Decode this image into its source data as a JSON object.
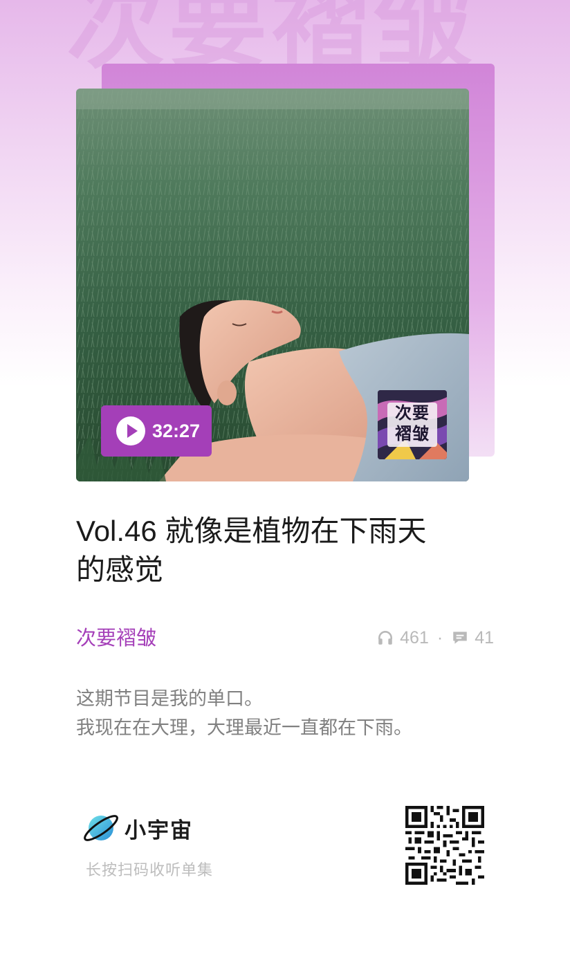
{
  "watermark_text": "次要褶皱",
  "cover": {
    "duration": "32:27",
    "logo_text_line1": "次要",
    "logo_text_line2": "褶皱"
  },
  "episode": {
    "title_line1": "Vol.46 就像是植物在下雨天",
    "title_line2": "的感觉"
  },
  "podcast": {
    "name": "次要褶皱",
    "play_count": "461",
    "separator": "·",
    "comment_count": "41"
  },
  "description": {
    "line1": "这期节目是我的单口。",
    "line2": "我现在在大理，大理最近一直都在下雨。"
  },
  "footer": {
    "brand_name": "小宇宙",
    "scan_hint": "长按扫码收听单集"
  },
  "colors": {
    "accent": "#a540b9",
    "badge": "#a43fb8",
    "background_top": "#e6b8ea",
    "title": "#1b1b1b",
    "muted": "#b9b9b9"
  },
  "icons": {
    "play": "play-icon",
    "headphones": "headphones-icon",
    "comment": "comment-icon",
    "brand_logo": "planet-logo-icon",
    "qr": "qr-code"
  }
}
